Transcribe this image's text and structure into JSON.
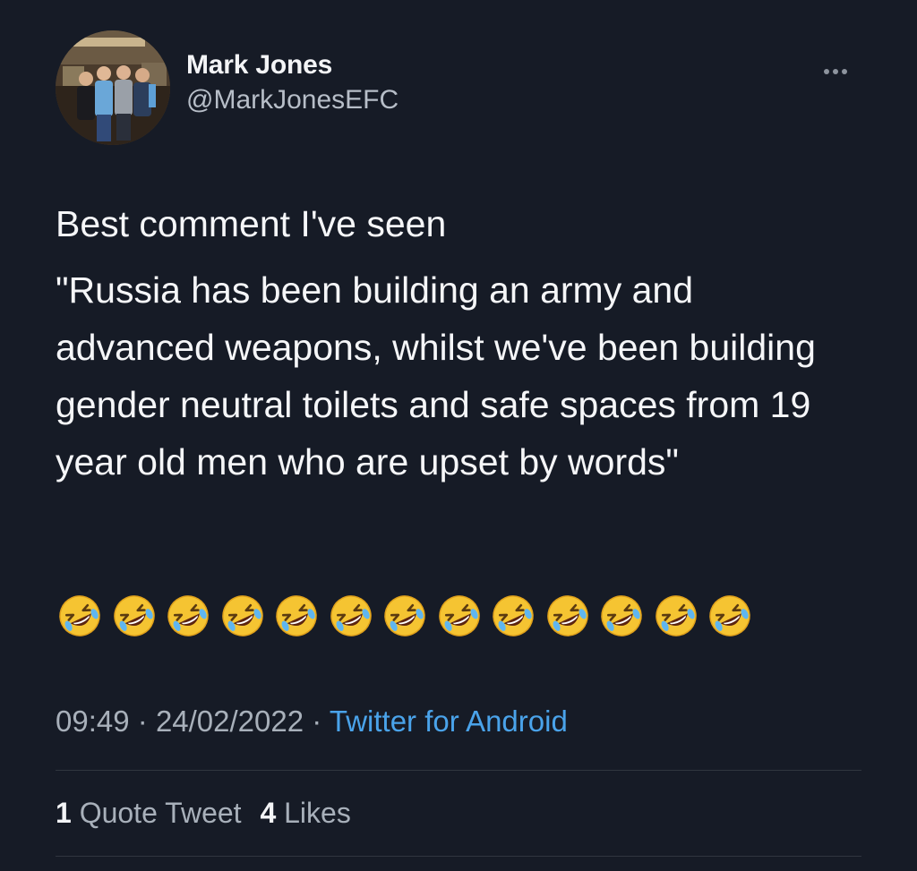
{
  "user": {
    "display_name": "Mark Jones",
    "handle": "@MarkJonesEFC"
  },
  "tweet": {
    "line1": "Best comment I've seen",
    "quote": "\"Russia has been building an army and advanced weapons, whilst we've been building gender neutral toilets and safe spaces from 19 year old men who are upset by words\"",
    "emoji_count": 13,
    "emoji_icon": "rolling-on-the-floor-laughing-icon"
  },
  "meta": {
    "time": "09:49",
    "separator": "·",
    "date": "24/02/2022",
    "source": "Twitter for Android"
  },
  "stats": {
    "quote_count": "1",
    "quote_label": "Quote Tweet",
    "like_count": "4",
    "like_label": "Likes"
  },
  "colors": {
    "background": "#161b26",
    "link": "#4aa3ea",
    "secondary_text": "#a8b0ba",
    "divider": "#30363f"
  }
}
